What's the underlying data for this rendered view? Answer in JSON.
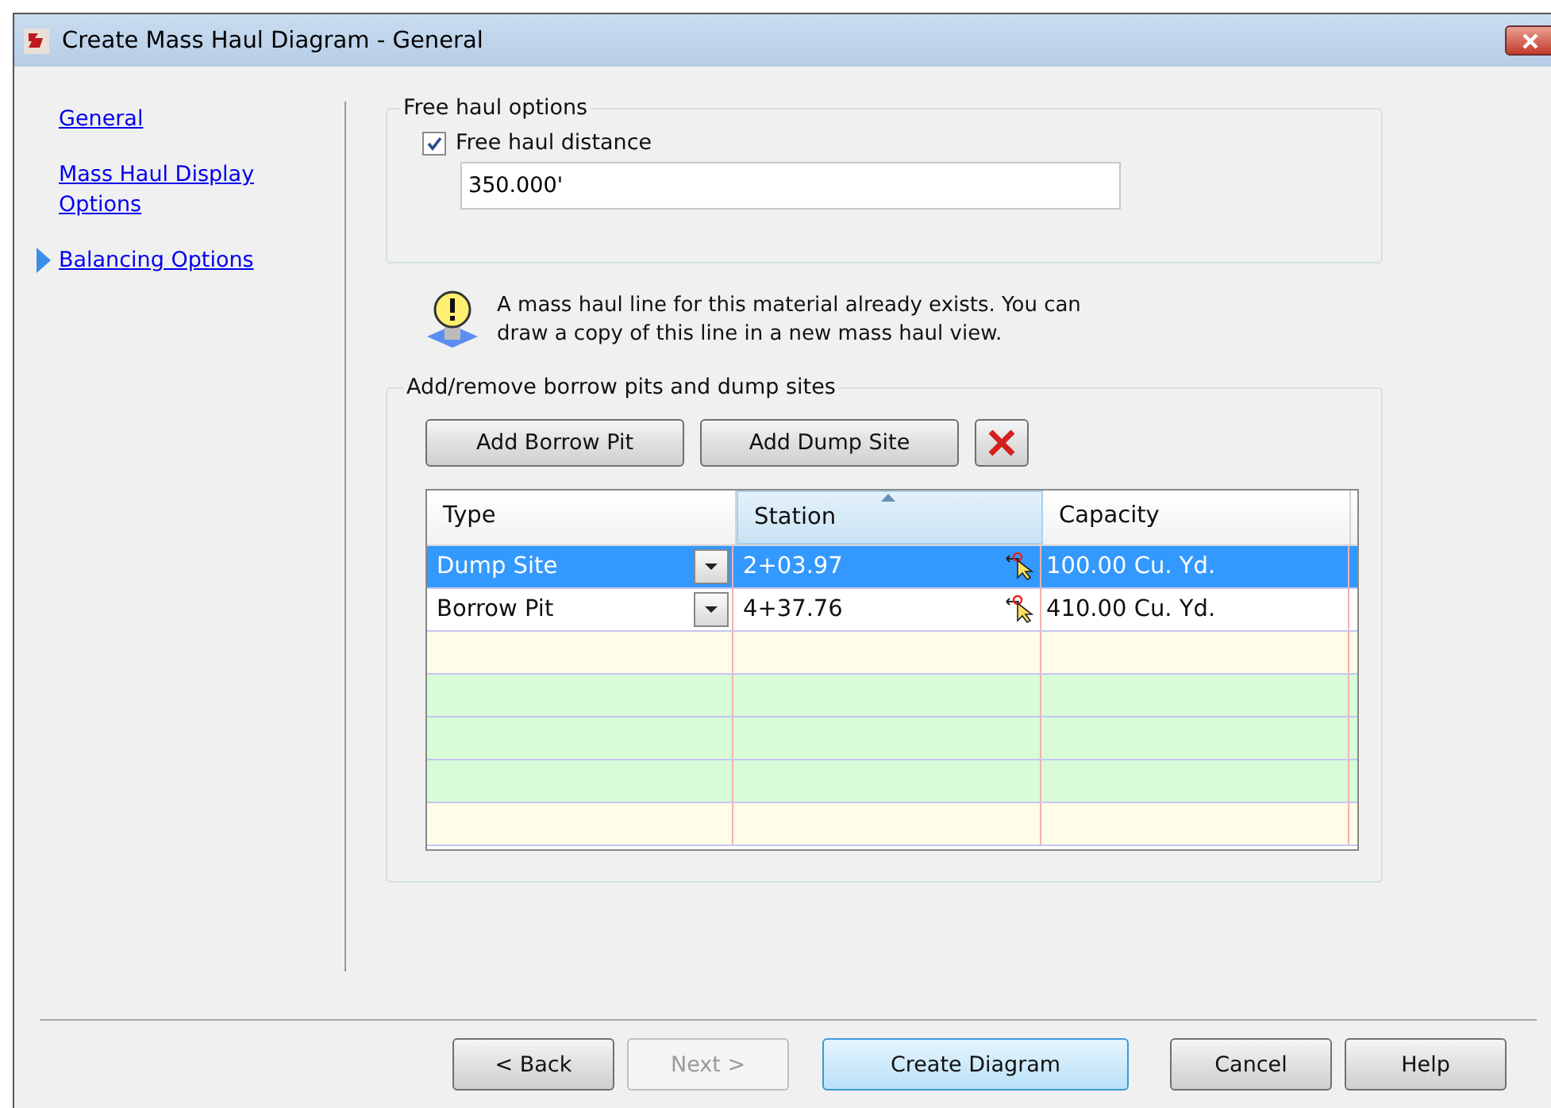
{
  "window": {
    "title": "Create Mass Haul Diagram - General"
  },
  "sidebar": {
    "items": [
      {
        "label": "General",
        "selected": false
      },
      {
        "label": "Mass Haul Display Options",
        "selected": false
      },
      {
        "label": "Balancing Options",
        "selected": true
      }
    ]
  },
  "free_haul": {
    "legend": "Free haul options",
    "checkbox": {
      "label": "Free haul distance",
      "checked": true
    },
    "distance": {
      "value": "350.000'"
    }
  },
  "notice": "A mass haul line for this material already exists. You can draw a copy of this line in a new mass haul view.",
  "sites": {
    "legend": "Add/remove borrow pits and dump sites",
    "buttons": [
      "Add Borrow Pit",
      "Add Dump Site"
    ],
    "table": {
      "columns": [
        {
          "label": "Type",
          "sorted": false
        },
        {
          "label": "Station",
          "sorted": true
        },
        {
          "label": "Capacity",
          "sorted": false
        }
      ],
      "rows": [
        {
          "type": "Dump Site",
          "station": "2+03.97",
          "capacity": "100.00 Cu. Yd.",
          "selected": true
        },
        {
          "type": "Borrow Pit",
          "station": "4+37.76",
          "capacity": "410.00 Cu. Yd.",
          "selected": false
        }
      ],
      "empty_rows": [
        {
          "color": "#fffde8"
        },
        {
          "color": "#d8fcd8"
        },
        {
          "color": "#d8fcd8"
        },
        {
          "color": "#d8fcd8"
        },
        {
          "color": "#fffde8"
        }
      ]
    }
  },
  "footer": {
    "buttons": [
      {
        "label": "< Back",
        "disabled": false,
        "default": false
      },
      {
        "label": "Next >",
        "disabled": true,
        "default": false
      },
      {
        "label": "Create Diagram",
        "disabled": false,
        "default": true
      },
      {
        "label": "Cancel",
        "disabled": false,
        "default": false
      },
      {
        "label": "Help",
        "disabled": false,
        "default": false
      }
    ]
  }
}
